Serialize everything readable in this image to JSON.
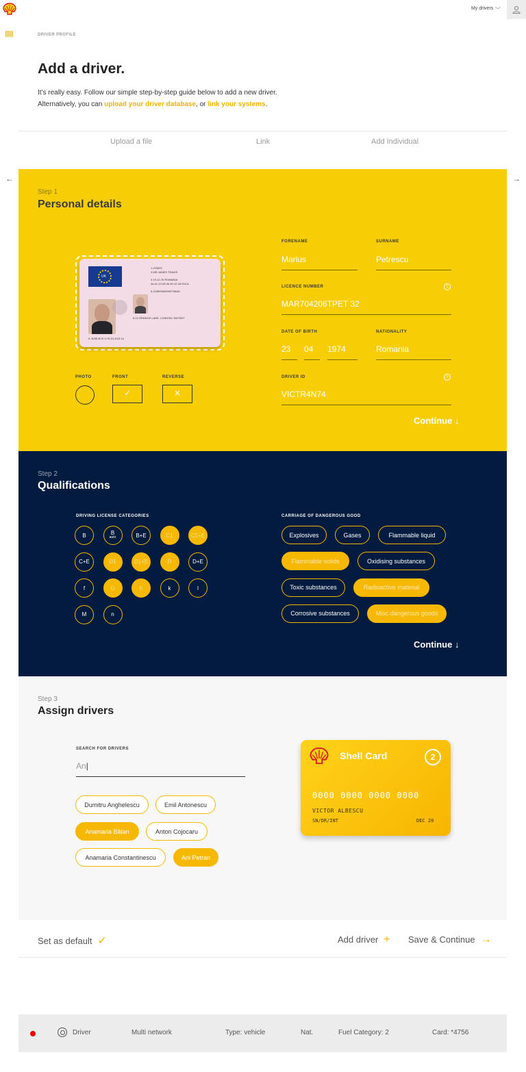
{
  "header": {
    "nav_label": "My drivers"
  },
  "page": {
    "breadcrumb": "DRIVER PROFILE",
    "title": "Add a driver.",
    "intro_text": "It's really easy. Follow our simple step-by-step guide below to add a new driver. Alternatively, you can ",
    "intro_link1": "upload your driver database",
    "intro_mid": ", or ",
    "intro_link2": "link your systems",
    "intro_end": "."
  },
  "tabs": [
    "Upload a file",
    "Link",
    "Add Individual"
  ],
  "step1": {
    "label": "Step 1",
    "title": "Personal details",
    "fields": {
      "forename_label": "FORENAME",
      "forename": "Marius",
      "surname_label": "SURNAME",
      "surname": "Petrescu",
      "licence_label": "LICENCE NUMBER",
      "licence": "MAR704206TPET 32",
      "dob_label": "DATE OF BIRTH",
      "dob_day": "23",
      "dob_month": "04",
      "dob_year": "1974",
      "nationality_label": "NATIONALITY",
      "nationality": "Romania",
      "driver_id_label": "DRIVER ID",
      "driver_id": "VICTR4N74"
    },
    "license_card": {
      "flag_code": "UK",
      "line1": "1.JONES",
      "line2": "2.MR JAMES TRAVIS",
      "line3": "3.19-12-76 ROMANIA",
      "line4": "4a.31-12-08 4b.30-12-18 DVLA",
      "line5": "5.JONES849999TS8AD",
      "line6": "8.14 GRANGE LANE, LONDON, NW78DT",
      "line7": "9. B,BE,B+E,C+E,D1,D1E,f,k"
    },
    "upload_labels": {
      "photo": "PHOTO",
      "front": "FRONT",
      "reverse": "REVERSE"
    },
    "front_mark": "✓",
    "reverse_mark": "✕",
    "continue": "Continue"
  },
  "step2": {
    "label": "Step 2",
    "title": "Qualifications",
    "categories_label": "DRIVING LICENSE CATEGORIES",
    "categories": [
      {
        "label": "B",
        "on": false
      },
      {
        "label": "B",
        "sub": "auto",
        "on": false
      },
      {
        "label": "B+E",
        "on": false
      },
      {
        "label": "C1",
        "on": true
      },
      {
        "label": "C1+E",
        "on": true
      },
      {
        "label": "C+E",
        "on": false
      },
      {
        "label": "D1",
        "on": true
      },
      {
        "label": "D1+E",
        "on": true
      },
      {
        "label": "D",
        "on": true
      },
      {
        "label": "D+E",
        "on": false
      },
      {
        "label": "f",
        "on": false
      },
      {
        "label": "G",
        "on": true
      },
      {
        "label": "h",
        "on": true
      },
      {
        "label": "k",
        "on": false
      },
      {
        "label": "l",
        "on": false
      },
      {
        "label": "M",
        "on": false
      },
      {
        "label": "n",
        "on": false
      }
    ],
    "dangerous_label": "CARRIAGE OF DANGEROUS GOOD",
    "dangerous": [
      {
        "label": "Explosives",
        "on": false
      },
      {
        "label": "Gases",
        "on": false
      },
      {
        "label": "Flammable liquid",
        "on": false
      },
      {
        "label": "Flammable solids",
        "on": true
      },
      {
        "label": "Oxidising substances",
        "on": false
      },
      {
        "label": "Toxic substances",
        "on": false
      },
      {
        "label": "Radioactive material",
        "on": true
      },
      {
        "label": "Corrosive substances",
        "on": false
      },
      {
        "label": "Misc dangerous goods",
        "on": true
      }
    ],
    "continue": "Continue"
  },
  "step3": {
    "label": "Step 3",
    "title": "Assign drivers",
    "search_label": "SEARCH FOR DRIVERS",
    "search_value": "An",
    "drivers": [
      {
        "name": "Dumitru Anghelescu",
        "on": false
      },
      {
        "name": "Emil Antonescu",
        "on": false
      },
      {
        "name": "Anamaria Bălan",
        "on": true
      },
      {
        "name": "Anton Cojocaru",
        "on": false
      },
      {
        "name": "Anamaria Constantinescu",
        "on": false
      },
      {
        "name": "Ani Petran",
        "on": true
      }
    ],
    "card": {
      "title": "Shell Card",
      "number": "2",
      "pan": "0000 0000 0000 0000",
      "holder": "VICTOR ALBESCU",
      "code": "SN/DR/INT",
      "expiry": "DEC 20"
    }
  },
  "actions": {
    "set_default": "Set as default",
    "add_driver": "Add driver",
    "save_continue": "Save & Continue"
  },
  "footer": {
    "driver": "Driver",
    "network": "Multi network",
    "type": "Type: vehicle",
    "nat": "Nat.",
    "fuel": "Fuel Category: 2",
    "card": "Card: *4756"
  },
  "colors": {
    "brand_yellow": "#f7cd06",
    "accent": "#f6b800",
    "navy": "#031b3e",
    "status_red": "#e00000"
  }
}
